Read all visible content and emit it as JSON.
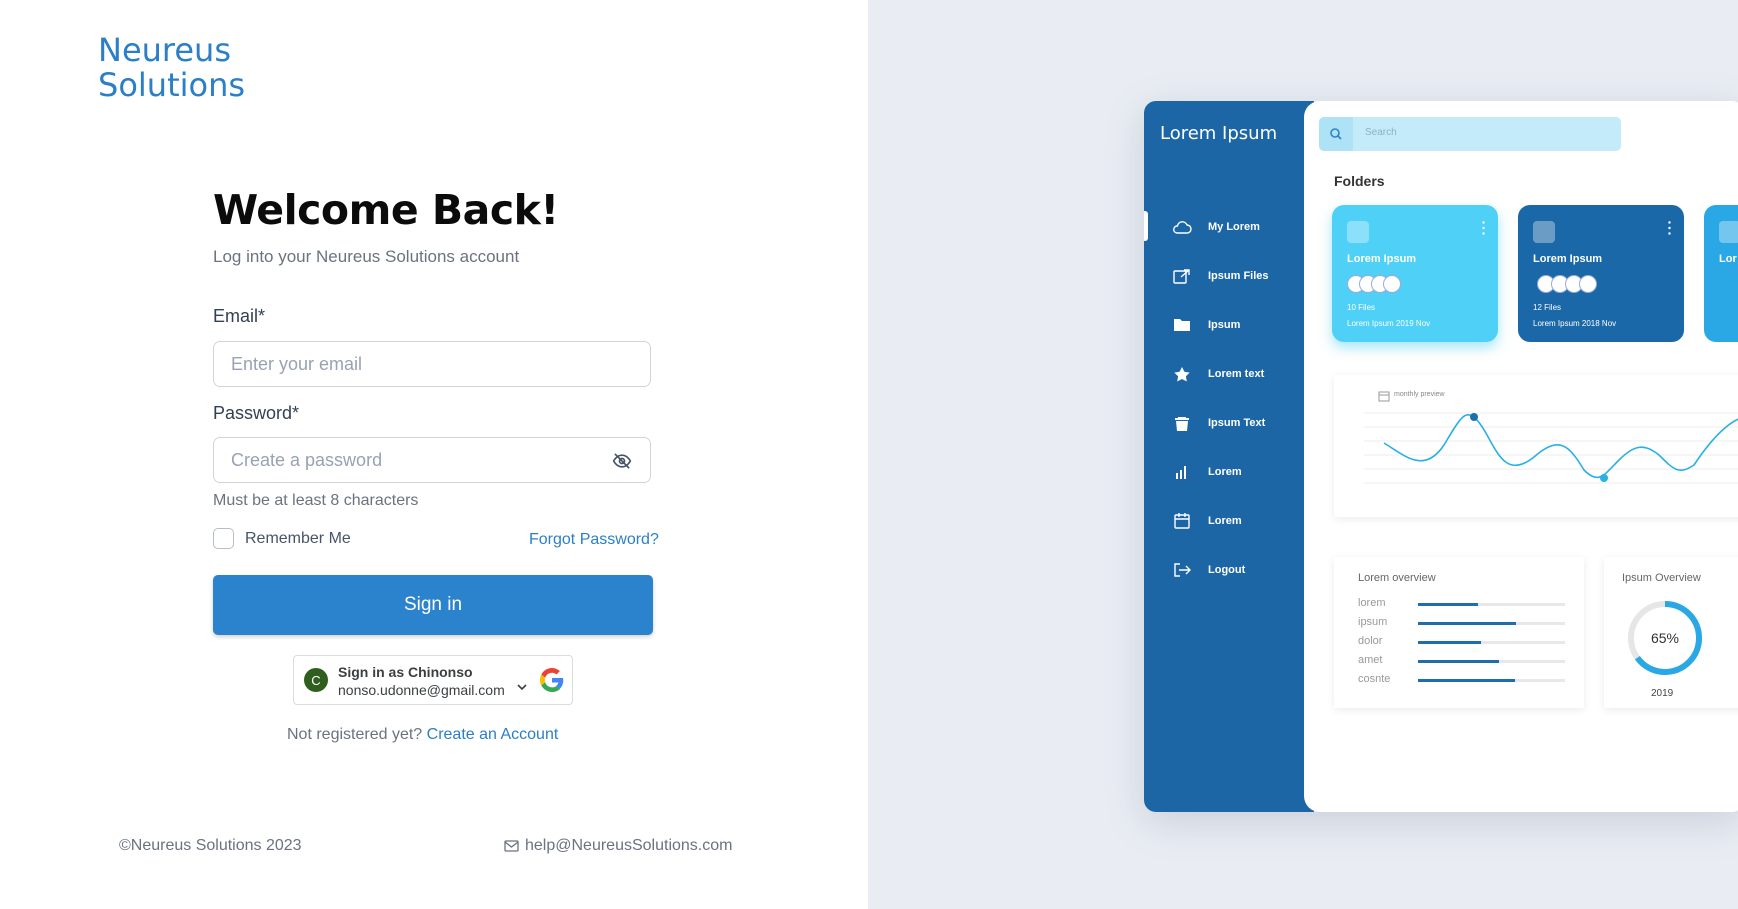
{
  "brand": {
    "line1": "Neureus",
    "line2": "Solutions"
  },
  "login": {
    "title": "Welcome Back!",
    "subtitle": "Log into your Neureus Solutions account",
    "email_label": "Email*",
    "email_placeholder": "Enter your email",
    "password_label": "Password*",
    "password_placeholder": "Create a password",
    "password_hint": "Must be at least 8 characters",
    "remember_label": "Remember Me",
    "forgot_label": "Forgot Password?",
    "signin_label": "Sign in"
  },
  "google": {
    "avatar_initial": "C",
    "name": "Sign in as Chinonso",
    "email": "nonso.udonne@gmail.com"
  },
  "register": {
    "prompt": "Not registered yet?",
    "link": "Create an Account"
  },
  "footer": {
    "copyright": "©Neureus Solutions 2023",
    "email": "help@NeureusSolutions.com"
  },
  "dashboard": {
    "logo": "Lorem Ipsum",
    "nav": [
      {
        "label": "My Lorem",
        "icon": "cloud-icon"
      },
      {
        "label": "Ipsum Files",
        "icon": "share-icon"
      },
      {
        "label": "Ipsum",
        "icon": "folder-icon"
      },
      {
        "label": "Lorem text",
        "icon": "star-icon"
      },
      {
        "label": "Ipsum Text",
        "icon": "trash-icon"
      },
      {
        "label": "Lorem",
        "icon": "bar-chart-icon"
      },
      {
        "label": "Lorem",
        "icon": "calendar-icon"
      },
      {
        "label": "Logout",
        "icon": "logout-icon"
      }
    ],
    "search_placeholder": "Search",
    "folders_title": "Folders",
    "cards": [
      {
        "name": "Lorem Ipsum",
        "files": "10 Files",
        "date": "Lorem Ipsum 2019 Nov",
        "color": "#4fd0f6"
      },
      {
        "name": "Lorem Ipsum",
        "files": "12 Files",
        "date": "Lorem Ipsum 2018 Nov",
        "color": "#1b68a8"
      },
      {
        "name": "Lor",
        "color": "#2aa8e6"
      }
    ],
    "chart_title": "monthly preview",
    "overview_title": "Lorem overview",
    "overview_rows": [
      {
        "label": "lorem",
        "value": 0.41
      },
      {
        "label": "ipsum",
        "value": 0.67
      },
      {
        "label": "dolor",
        "value": 0.43
      },
      {
        "label": "amet",
        "value": 0.55
      },
      {
        "label": "cosnte",
        "value": 0.66
      }
    ],
    "ipsum_overview_title": "Ipsum Overview",
    "ipsum_percent": "65%",
    "ipsum_percent_value": 65,
    "ipsum_year": "2019"
  },
  "colors": {
    "accent": "#2a83cc",
    "sidebar": "#1c66a6",
    "card_light": "#4fd0f6"
  }
}
